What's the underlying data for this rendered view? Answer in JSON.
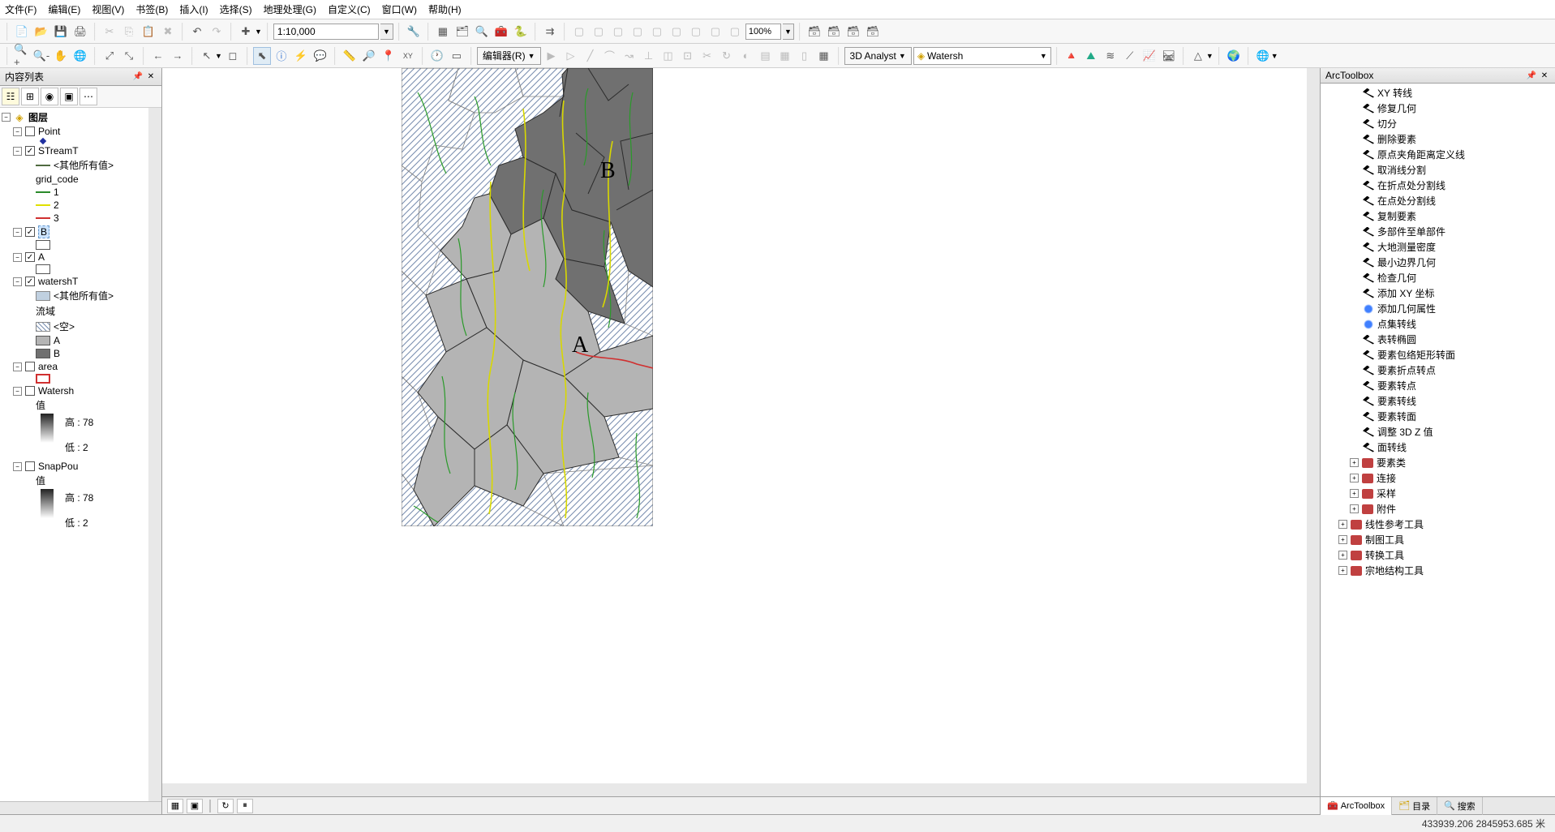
{
  "menu": {
    "items": [
      "文件(F)",
      "编辑(E)",
      "视图(V)",
      "书签(B)",
      "插入(I)",
      "选择(S)",
      "地理处理(G)",
      "自定义(C)",
      "窗口(W)",
      "帮助(H)"
    ]
  },
  "toolbar1": {
    "scale_value": "1:10,000",
    "zoom_pct": "100%"
  },
  "toolbar2": {
    "editor_label": "编辑器(R)",
    "analyst_label": "3D Analyst",
    "layer_combo": "Watersh"
  },
  "toc": {
    "title": "内容列表",
    "root_label": "图层",
    "layers": {
      "point": "Point",
      "streamT": "STreamT",
      "streamT_other": "<其他所有值>",
      "grid_code": "grid_code",
      "v1": "1",
      "v2": "2",
      "v3": "3",
      "B": "B",
      "A": "A",
      "watershT": "watershT",
      "watershT_other": "<其他所有值>",
      "watershT_field": "流域",
      "empty": "<空>",
      "Alab": "A",
      "Blab": "B",
      "area": "area",
      "watersh": "Watersh",
      "value": "值",
      "high": "高 : 78",
      "low": "低 : 2",
      "snappou": "SnapPou"
    }
  },
  "map": {
    "label_A": "A",
    "label_B": "B"
  },
  "toolbox": {
    "title": "ArcToolbox",
    "tools": [
      "XY 转线",
      "修复几何",
      "切分",
      "删除要素",
      "原点夹角距离定义线",
      "取消线分割",
      "在折点处分割线",
      "在点处分割线",
      "复制要素",
      "多部件至单部件",
      "大地测量密度",
      "最小边界几何",
      "检查几何",
      "添加 XY 坐标",
      "添加几何属性",
      "点集转线",
      "表转椭圆",
      "要素包络矩形转面",
      "要素折点转点",
      "要素转点",
      "要素转线",
      "要素转面",
      "调整 3D Z 值",
      "面转线"
    ],
    "script_tools_idx": [
      14,
      15
    ],
    "toolsets": [
      "要素类",
      "连接",
      "采样",
      "附件"
    ],
    "toolboxes": [
      "线性参考工具",
      "制图工具",
      "转换工具",
      "宗地结构工具"
    ],
    "tabs": [
      "ArcToolbox",
      "目录",
      "搜索"
    ]
  },
  "status": {
    "coords": "433939.206  2845953.685 米"
  }
}
